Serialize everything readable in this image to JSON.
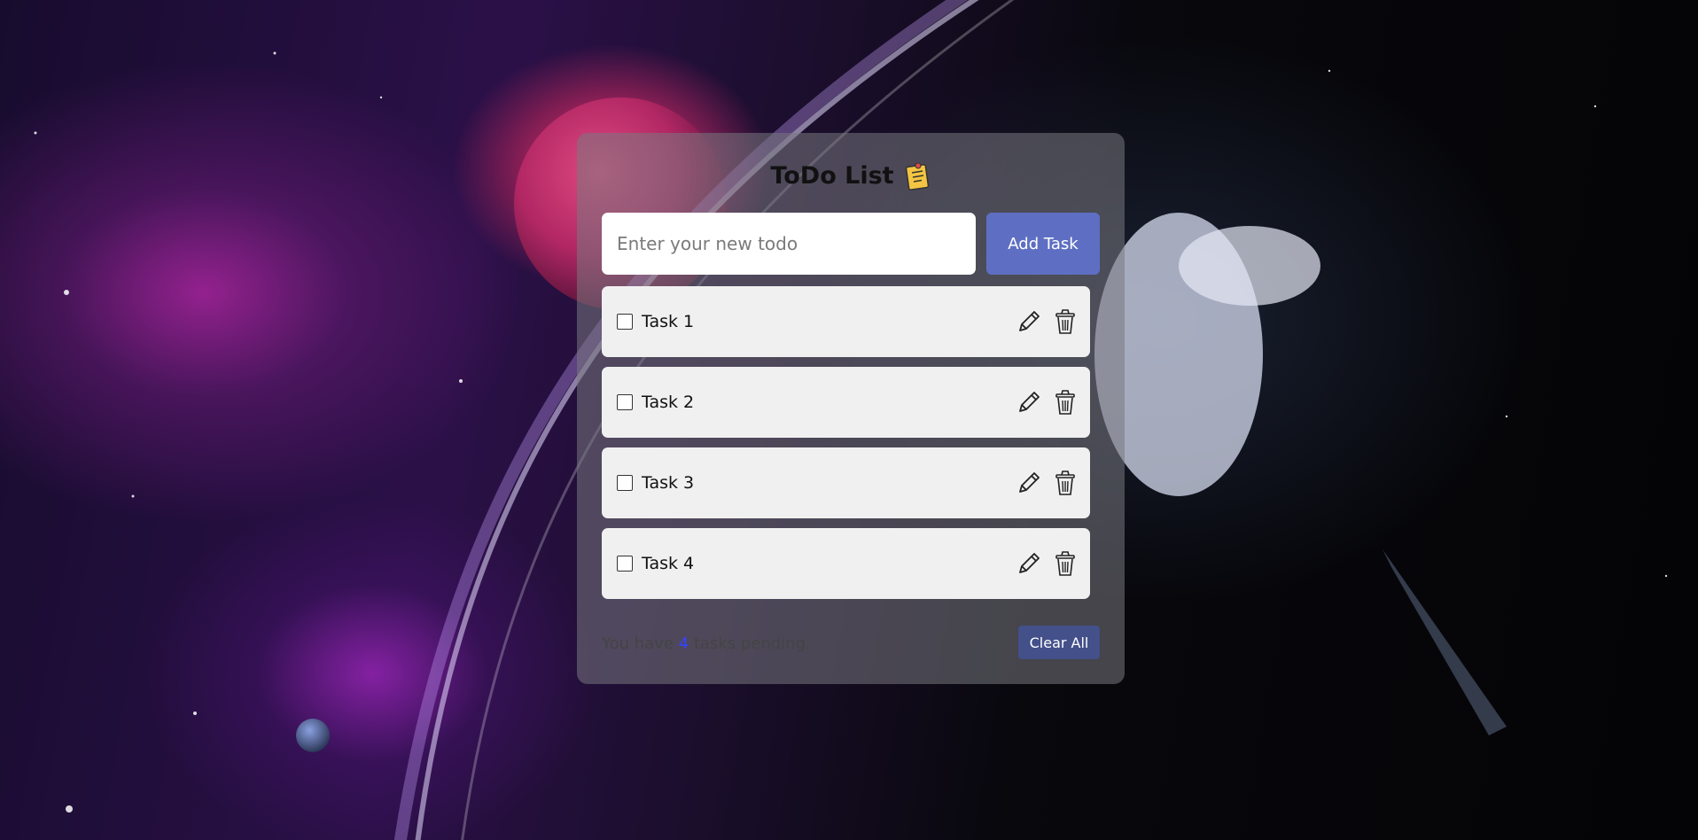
{
  "app": {
    "title": "ToDo List"
  },
  "input": {
    "placeholder": "Enter your new todo",
    "value": ""
  },
  "buttons": {
    "add_task": "Add Task",
    "clear_all": "Clear All"
  },
  "tasks": [
    {
      "label": "Task 1",
      "checked": false
    },
    {
      "label": "Task 2",
      "checked": false
    },
    {
      "label": "Task 3",
      "checked": false
    },
    {
      "label": "Task 4",
      "checked": false
    }
  ],
  "footer": {
    "prefix": "You have",
    "count": "4",
    "suffix": "tasks pending."
  },
  "icons": {
    "title_icon": "memo-icon",
    "edit": "pencil-icon",
    "delete": "trash-icon"
  },
  "colors": {
    "accent": "#6276d6",
    "clear_button": "#43508a",
    "count": "#3344ff"
  }
}
